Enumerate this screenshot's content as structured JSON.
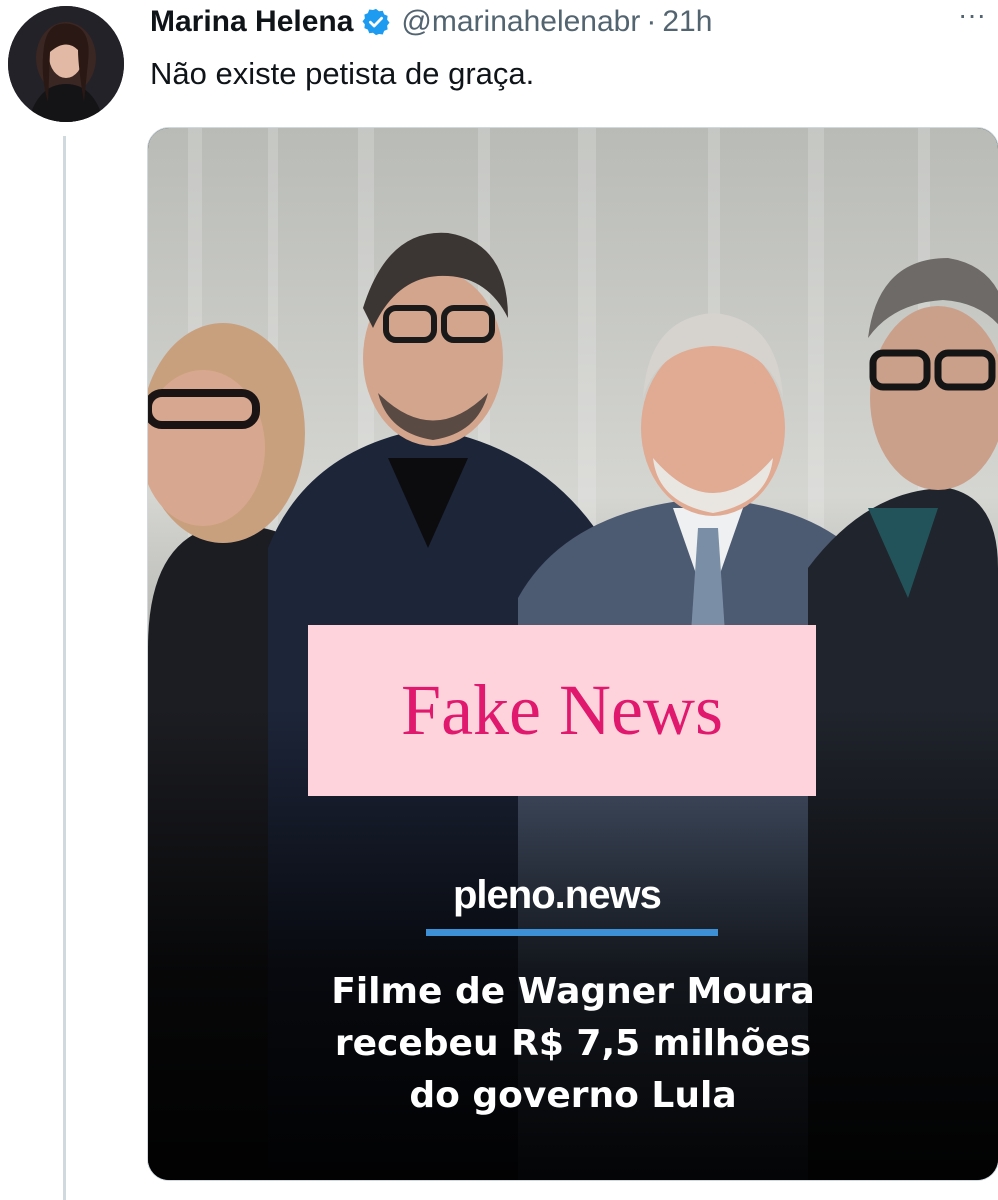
{
  "tweet": {
    "author_name": "Marina Helena",
    "handle": "@marinahelenabr",
    "separator": "·",
    "time": "21h",
    "more_icon": "more-horizontal-icon",
    "text": "Não existe petista de graça.",
    "verified_color": "#1d9bf0"
  },
  "media": {
    "label_stamp": "Fake News",
    "brand": "pleno.news",
    "headline_lines": [
      "Filme de Wagner Moura",
      "recebeu R$ 7,5 milhões",
      "do governo Lula"
    ],
    "stamp_color": "#e0186e",
    "stamp_bg": "#ffd3db",
    "brand_accent": "#3d8fd6"
  }
}
